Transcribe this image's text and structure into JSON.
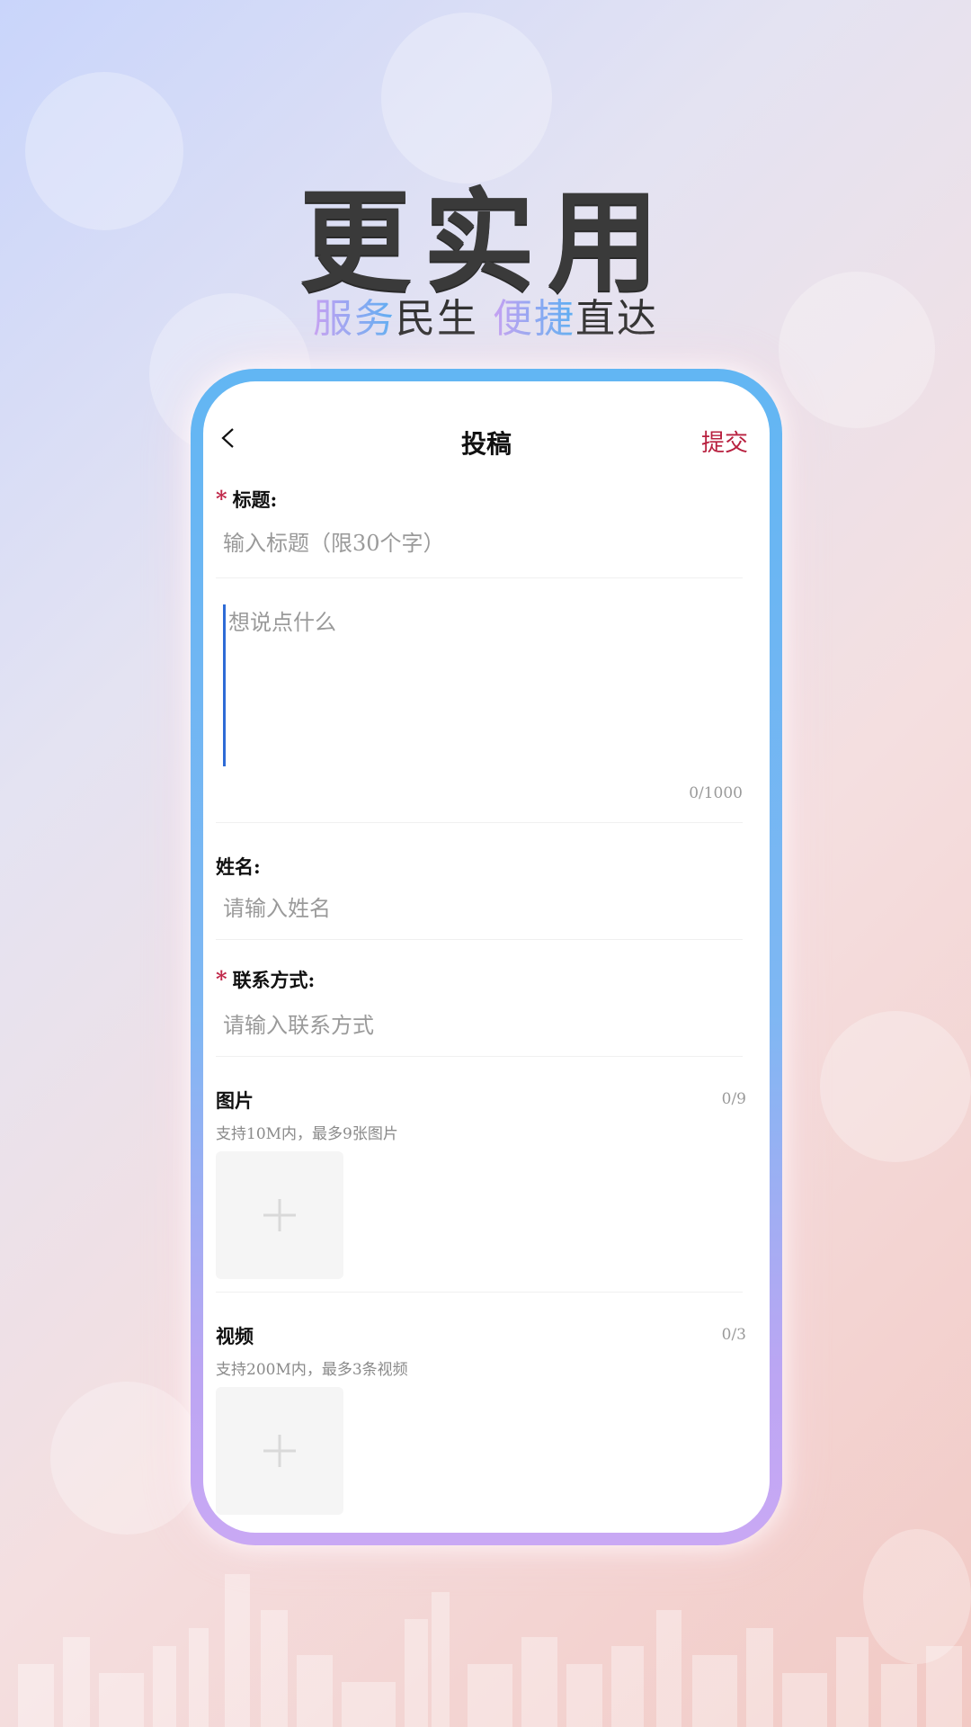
{
  "headline": "更实用",
  "subline": {
    "part1": "服务",
    "part2": "民生",
    "part3": "便捷",
    "part4": "直达"
  },
  "colors": {
    "accent": "#b8203f",
    "required_star": "#c0284a",
    "frame_top": "#62b6f3",
    "frame_bottom": "#c9a8f4"
  },
  "nav": {
    "back_icon": "chevron-left-icon",
    "title": "投稿",
    "submit_label": "提交"
  },
  "form": {
    "title_field": {
      "required_mark": "*",
      "label": "标题:",
      "placeholder": "输入标题（限30个字）"
    },
    "content_field": {
      "placeholder": "想说点什么",
      "counter": "0/1000"
    },
    "name_field": {
      "label": "姓名:",
      "placeholder": "请输入姓名"
    },
    "contact_field": {
      "required_mark": "*",
      "label": "联系方式:",
      "placeholder": "请输入联系方式"
    },
    "images": {
      "label": "图片",
      "counter": "0/9",
      "hint": "支持10M内，最多9张图片",
      "add_icon": "plus-icon"
    },
    "videos": {
      "label": "视频",
      "counter": "0/3",
      "hint": "支持200M内，最多3条视频",
      "add_icon": "plus-icon"
    }
  }
}
